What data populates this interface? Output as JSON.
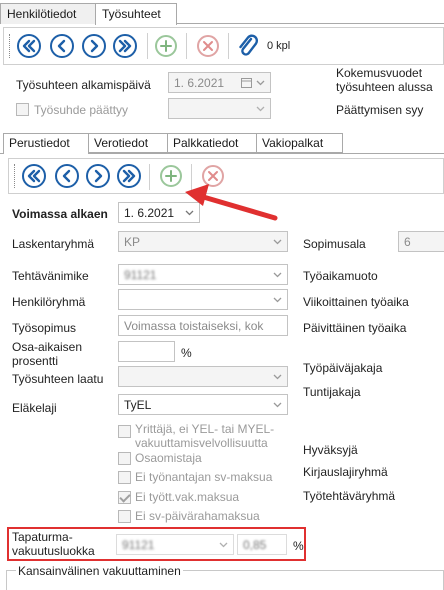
{
  "tabs": [
    {
      "label": "Henkilötiedot",
      "active": false
    },
    {
      "label": "Työsuhteet",
      "active": true
    }
  ],
  "toolbar": {
    "count_label": "0 kpl"
  },
  "header": {
    "start_date_label": "Työsuhteen alkamispäivä",
    "start_date_value": "1.  6.2021",
    "ended_label": "Työsuhde päättyy",
    "experience_label": "Kokemusvuodet työsuhteen alussa",
    "end_reason_label": "Päättymisen syy"
  },
  "subtabs": [
    {
      "label": "Perustiedot",
      "active": true
    },
    {
      "label": "Verotiedot",
      "active": false
    },
    {
      "label": "Palkkatiedot",
      "active": false
    },
    {
      "label": "Vakiopalkat",
      "active": false
    }
  ],
  "form": {
    "valid_from_label": "Voimassa alkaen",
    "valid_from_value": "1.  6.2021",
    "cost_group_label": "Laskentaryhmä",
    "cost_group_value": "KP",
    "job_title_label": "Tehtävänimike",
    "job_title_value": "91121",
    "person_group_label": "Henkilöryhmä",
    "person_group_value": "",
    "contract_label": "Työsopimus",
    "contract_value": "Voimassa toistaiseksi, kok",
    "part_time_label": "Osa-aikaisen prosentti",
    "part_time_value": "",
    "part_time_unit": "%",
    "quality_label": "Työsuhteen laatu",
    "quality_value": "",
    "pension_label": "Eläkelaji",
    "pension_value": "TyEL",
    "checkboxes": [
      {
        "label": "Yrittäjä, ei YEL- tai MYEL-vakuuttamisvelvollisuutta",
        "checked": false
      },
      {
        "label": "Osaomistaja",
        "checked": false
      },
      {
        "label": "Ei työnantajan sv-maksua",
        "checked": false
      },
      {
        "label": "Ei tyött.vak.maksua",
        "checked": true
      },
      {
        "label": "Ei sv-päivärahamaksua",
        "checked": false
      }
    ],
    "accident_label": "Tapaturma-vakuutusluokka",
    "accident_value": "91121",
    "accident_pct": "0,85",
    "accident_unit": "%",
    "intl_label": "Kansainvälinen vakuuttaminen"
  },
  "right": {
    "agreement_label": "Sopimusala",
    "agreement_value": "6",
    "worktime_form_label": "Työaikamuoto",
    "weekly_label": "Viikoittainen työaika",
    "daily_label": "Päivittäinen työaika",
    "workday_period_label": "Työpäiväjakaja",
    "hour_period_label": "Tuntijakaja",
    "approver_label": "Hyväksyjä",
    "posting_group_label": "Kirjauslajiryhmä",
    "task_group_label": "Työtehtäväryhmä"
  },
  "colors": {
    "nav": "#1d5fa8",
    "add": "#4a9a4a",
    "delete": "#d04a4a",
    "highlight": "#e03030"
  }
}
